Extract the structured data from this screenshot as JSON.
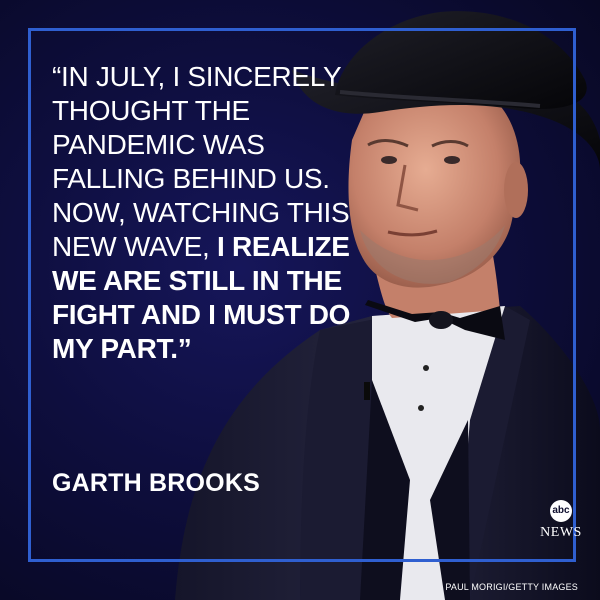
{
  "quote": {
    "regular": "“IN JULY, I SINCERELY THOUGHT THE PANDEMIC WAS FALLING BEHIND US. NOW, WATCHING THIS NEW WAVE, ",
    "emphasis": "I REALIZE WE ARE STILL IN THE FIGHT AND I MUST DO MY PART.”"
  },
  "attribution": "GARTH BROOKS",
  "logo": {
    "mark": "abc",
    "name": "NEWS"
  },
  "credit": "PAUL MORIGI/GETTY IMAGES",
  "colors": {
    "background": "#0c0c2c",
    "frame": "#2f5fd0",
    "text": "#ffffff"
  }
}
